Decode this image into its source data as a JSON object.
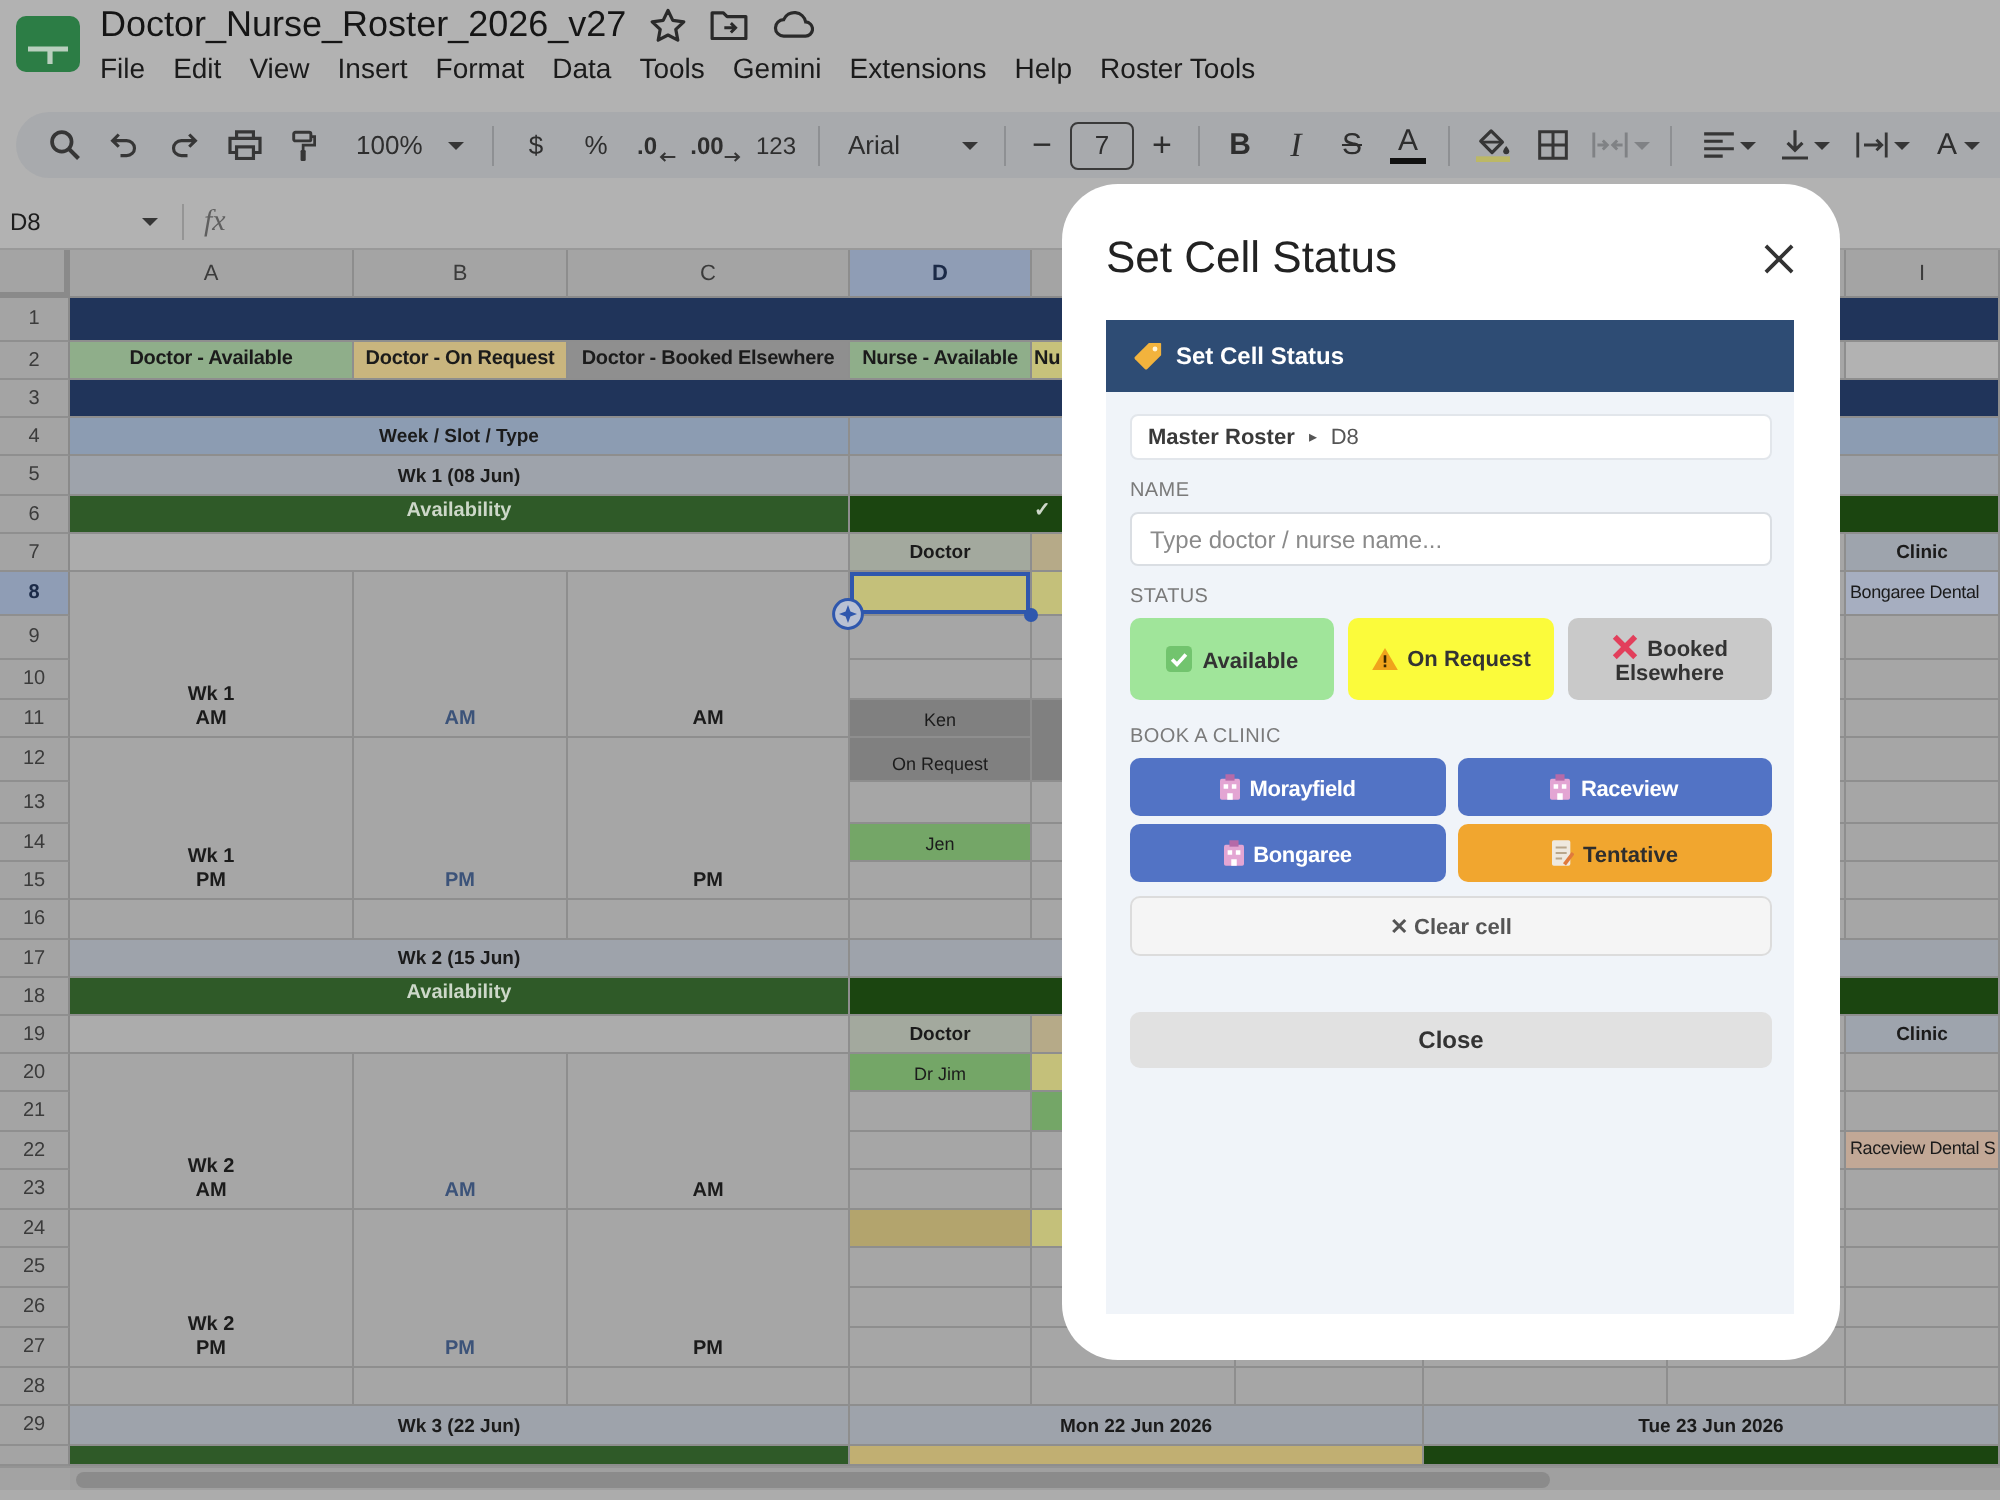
{
  "document": {
    "title": "Doctor_Nurse_Roster_2026_v27"
  },
  "menu": [
    "File",
    "Edit",
    "View",
    "Insert",
    "Format",
    "Data",
    "Tools",
    "Gemini",
    "Extensions",
    "Help",
    "Roster Tools"
  ],
  "toolbar": {
    "zoom": "100%",
    "formats": [
      {
        "label": "$",
        "kind": "plain"
      },
      {
        "label": "%",
        "kind": "plain"
      },
      {
        "label": ".0",
        "kind": "decrease"
      },
      {
        "label": ".00",
        "kind": "increase"
      },
      {
        "label": "123",
        "kind": "small"
      }
    ],
    "font": "Arial",
    "font_size": "7",
    "size_steps": [
      "−",
      "+"
    ],
    "text_styles": [
      {
        "label": "B",
        "kind": "bold"
      },
      {
        "label": "I",
        "kind": "italic"
      },
      {
        "label": "S",
        "kind": "strike"
      },
      {
        "label": "A",
        "kind": "color"
      }
    ],
    "merge": {
      "disabled": true
    },
    "rotation_label": "A"
  },
  "formula_bar": {
    "cell": "D8",
    "label": "fx"
  },
  "sheet": {
    "columns": [
      {
        "label": "A",
        "selected": false
      },
      {
        "label": "B",
        "selected": false
      },
      {
        "label": "C",
        "selected": false
      },
      {
        "label": "D",
        "selected": true
      },
      {
        "label": "I",
        "selected": false
      }
    ],
    "rows": [
      {
        "number": "1",
        "selected": false
      },
      {
        "number": "2",
        "selected": false
      },
      {
        "number": "3",
        "selected": false
      },
      {
        "number": "4",
        "selected": false
      },
      {
        "number": "5",
        "selected": false
      },
      {
        "number": "6",
        "selected": false
      },
      {
        "number": "7",
        "selected": false
      },
      {
        "number": "8",
        "selected": true
      },
      {
        "number": "9",
        "selected": false
      },
      {
        "number": "10",
        "selected": false
      },
      {
        "number": "11",
        "selected": false
      },
      {
        "number": "12",
        "selected": false
      },
      {
        "number": "13",
        "selected": false
      },
      {
        "number": "14",
        "selected": false
      },
      {
        "number": "15",
        "selected": false
      },
      {
        "number": "16",
        "selected": false
      },
      {
        "number": "17",
        "selected": false
      },
      {
        "number": "18",
        "selected": false
      },
      {
        "number": "19",
        "selected": false
      },
      {
        "number": "20",
        "selected": false
      },
      {
        "number": "21",
        "selected": false
      },
      {
        "number": "22",
        "selected": false
      },
      {
        "number": "23",
        "selected": false
      },
      {
        "number": "24",
        "selected": false
      },
      {
        "number": "25",
        "selected": false
      },
      {
        "number": "26",
        "selected": false
      },
      {
        "number": "27",
        "selected": false
      },
      {
        "number": "28",
        "selected": false
      },
      {
        "number": "29",
        "selected": false
      }
    ],
    "cells": [
      {
        "kind": "fill",
        "color": "#20345a",
        "selected": false
      },
      {
        "kind": "legend",
        "text": "Doctor - Available",
        "color": "#8fae8a",
        "selected": false
      },
      {
        "kind": "legend",
        "text": "Doctor - On Request",
        "color": "#c9b57e",
        "selected": false
      },
      {
        "kind": "legend",
        "text": "Doctor - Booked Elsewhere",
        "color": "#8f8f8f",
        "selected": false
      },
      {
        "kind": "legend",
        "text": "Nurse - Available",
        "color": "#8fae8a",
        "selected": false
      },
      {
        "kind": "legend_start",
        "text": "Nu",
        "color": "#c7c27b",
        "selected": false
      },
      {
        "kind": "fill",
        "color": "#b2b2b2",
        "selected": false
      },
      {
        "kind": "fill",
        "color": "#20345a",
        "selected": false
      },
      {
        "kind": "title",
        "text": "Week / Slot / Type",
        "color": "#8c9cb2",
        "selected": false
      },
      {
        "kind": "fill",
        "color": "#8c9cb2",
        "selected": false
      },
      {
        "kind": "title",
        "text": "Wk 1 (08 Jun)",
        "color": "#9ea3ab",
        "selected": false
      },
      {
        "kind": "fill",
        "color": "#9ea3ab",
        "selected": false
      },
      {
        "kind": "section",
        "text": "Availability",
        "color": "#2f5a28",
        "selected": false
      },
      {
        "kind": "section",
        "text": "✓",
        "color": "#1b4510",
        "selected": false
      },
      {
        "kind": "fill",
        "color": "#1b4510",
        "selected": false
      },
      {
        "kind": "fill",
        "color": "#acacac",
        "selected": false
      },
      {
        "kind": "title",
        "text": "Doctor",
        "color": "#a3a99e",
        "selected": false
      },
      {
        "kind": "fill",
        "color": "#b6aa88",
        "selected": false
      },
      {
        "kind": "title",
        "text": "Clinic",
        "color": "#9ea4ad",
        "selected": false
      },
      {
        "kind": "label",
        "text": "Wk 1\nAM",
        "selected": false
      },
      {
        "kind": "slot",
        "text": "AM",
        "selected": false
      },
      {
        "kind": "label",
        "text": "AM",
        "selected": false
      },
      {
        "kind": "fill",
        "color": "#c4c07a",
        "selected": true
      },
      {
        "kind": "fill",
        "color": "#c4c07a",
        "selected": false
      },
      {
        "kind": "clinic",
        "text": "Bongaree Dental",
        "color": "#a6aec0",
        "selected": false
      },
      {
        "kind": "entry",
        "text": "Ken",
        "color": "#808080",
        "selected": false
      },
      {
        "kind": "fill",
        "color": "#808080",
        "selected": false
      },
      {
        "kind": "entry",
        "text": "On Request",
        "color": "#808080",
        "selected": false
      },
      {
        "kind": "label",
        "text": "Wk 1\nPM",
        "selected": false
      },
      {
        "kind": "slot",
        "text": "PM",
        "selected": false
      },
      {
        "kind": "label",
        "text": "PM",
        "selected": false
      },
      {
        "kind": "entry",
        "text": "Jen",
        "color": "#74a667",
        "selected": false
      },
      {
        "kind": "title",
        "text": "Wk 2 (15 Jun)",
        "color": "#9ea3ab",
        "selected": false
      },
      {
        "kind": "fill",
        "color": "#9ea3ab",
        "selected": false
      },
      {
        "kind": "section",
        "text": "Availability",
        "color": "#2f5a28",
        "selected": false
      },
      {
        "kind": "fill",
        "color": "#1b4510",
        "selected": false
      },
      {
        "kind": "fill",
        "color": "#acacac",
        "selected": false
      },
      {
        "kind": "title",
        "text": "Doctor",
        "color": "#a3a99e",
        "selected": false
      },
      {
        "kind": "fill",
        "color": "#b6aa88",
        "selected": false
      },
      {
        "kind": "title",
        "text": "Clinic",
        "color": "#9ea4ad",
        "selected": false
      },
      {
        "kind": "label",
        "text": "Wk 2\nAM",
        "selected": false
      },
      {
        "kind": "slot",
        "text": "AM",
        "selected": false
      },
      {
        "kind": "label",
        "text": "AM",
        "selected": false
      },
      {
        "kind": "entry",
        "text": "Dr Jim",
        "color": "#74a667",
        "selected": false
      },
      {
        "kind": "fill",
        "color": "#c4c07a",
        "selected": false
      },
      {
        "kind": "fill",
        "color": "#74a667",
        "selected": false
      },
      {
        "kind": "clinic",
        "text": "Raceview Dental S",
        "color": "#c2a896",
        "selected": false
      },
      {
        "kind": "label",
        "text": "Wk 2\nPM",
        "selected": false
      },
      {
        "kind": "slot",
        "text": "PM",
        "selected": false
      },
      {
        "kind": "label",
        "text": "PM",
        "selected": false
      },
      {
        "kind": "fill",
        "color": "#b3a46d",
        "selected": false
      },
      {
        "kind": "fill",
        "color": "#c4c07a",
        "selected": false
      },
      {
        "kind": "title",
        "text": "Wk 3 (22 Jun)",
        "color": "#9ea3ab",
        "selected": false
      },
      {
        "kind": "title",
        "text": "Mon 22 Jun 2026",
        "color": "#9ea3ab",
        "selected": false
      },
      {
        "kind": "title",
        "text": "Tue 23 Jun 2026",
        "color": "#9ea3ab",
        "selected": false
      },
      {
        "kind": "fill",
        "color": "#2f5a28",
        "selected": false
      },
      {
        "kind": "fill",
        "color": "#c1af72",
        "selected": false
      },
      {
        "kind": "fill",
        "color": "#1b4510",
        "selected": false
      }
    ]
  },
  "dialog": {
    "title": "Set Cell Status",
    "panel_title": "Set Cell Status",
    "breadcrumb": {
      "sheet": "Master Roster",
      "separator": "▸",
      "cell": "D8"
    },
    "name": {
      "label": "NAME",
      "placeholder": "Type doctor / nurse name..."
    },
    "status": {
      "label": "STATUS",
      "options": [
        {
          "label": "Available",
          "kind": "available",
          "color": "#a0e59a"
        },
        {
          "label": "On Request",
          "kind": "request",
          "color": "#fbfb3b"
        },
        {
          "label": "Booked Elsewhere",
          "kind": "elsewhere",
          "color": "#c9c9c9"
        }
      ]
    },
    "clinics": {
      "label": "BOOK A CLINIC",
      "options": [
        {
          "label": "Morayfield",
          "kind": "clinic",
          "color": "#5273c5"
        },
        {
          "label": "Raceview",
          "kind": "clinic",
          "color": "#5273c5"
        },
        {
          "label": "Bongaree",
          "kind": "clinic",
          "color": "#5273c5"
        },
        {
          "label": "Tentative",
          "kind": "tentative",
          "color": "#f1a62f"
        }
      ]
    },
    "clear_label": "✕ Clear cell",
    "close_label": "Close"
  }
}
